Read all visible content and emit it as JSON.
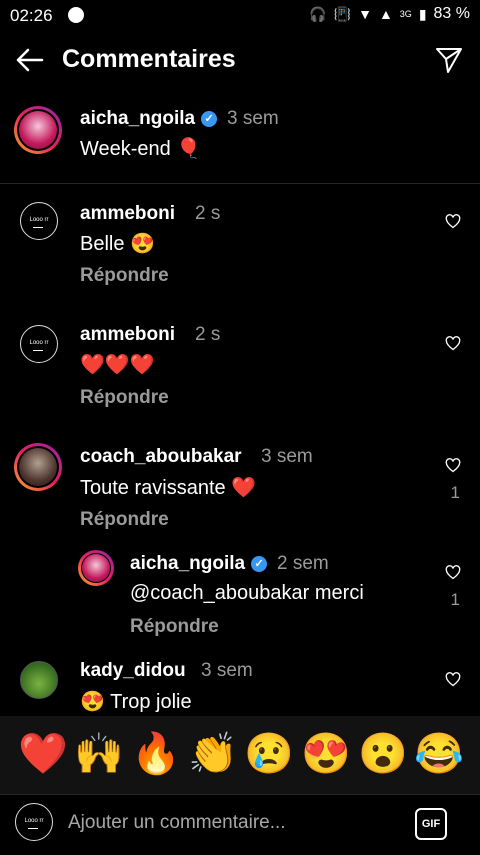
{
  "status": {
    "time": "02:26",
    "battery": "83 %",
    "network": "3G"
  },
  "header": {
    "title": "Commentaires"
  },
  "caption": {
    "username": "aicha_ngoila",
    "time": "3 sem",
    "text": "Week-end 🎈"
  },
  "comments": [
    {
      "username": "ammeboni",
      "time": "2 s",
      "text": "Belle 😍",
      "reply": "Répondre",
      "likes": ""
    },
    {
      "username": "ammeboni",
      "time": "2 s",
      "text": "❤️❤️❤️",
      "reply": "Répondre",
      "likes": ""
    },
    {
      "username": "coach_aboubakar",
      "time": "3 sem",
      "text": "Toute ravissante ❤️",
      "reply": "Répondre",
      "likes": "1"
    },
    {
      "username": "aicha_ngoila",
      "time": "2 sem",
      "text": "@coach_aboubakar merci",
      "reply": "Répondre",
      "likes": "1"
    },
    {
      "username": "kady_didou",
      "time": "3 sem",
      "text": "😍 Trop jolie",
      "reply": "",
      "likes": ""
    }
  ],
  "avatar_text": "Looo rr",
  "quick_emojis": [
    "❤️",
    "🙌",
    "🔥",
    "👏",
    "😢",
    "😍",
    "😮",
    "😂"
  ],
  "composer": {
    "placeholder": "Ajouter un commentaire...",
    "gif_label": "GIF"
  }
}
